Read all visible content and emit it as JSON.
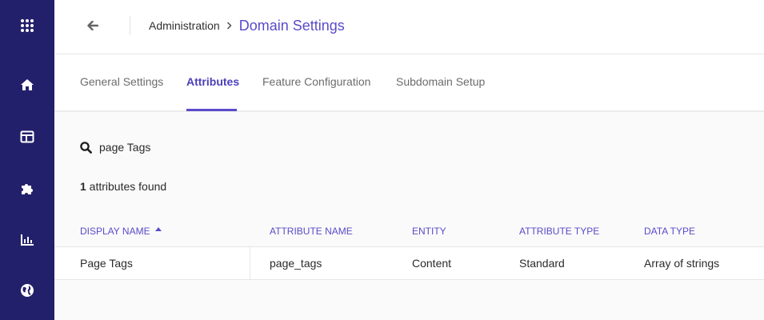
{
  "sidebar": {
    "items": [
      {
        "icon": "apps-grid-icon"
      },
      {
        "icon": "home-icon"
      },
      {
        "icon": "layout-icon"
      },
      {
        "icon": "puzzle-icon"
      },
      {
        "icon": "bar-chart-icon"
      },
      {
        "icon": "globe-icon"
      }
    ]
  },
  "header": {
    "breadcrumb_parent": "Administration",
    "breadcrumb_current": "Domain Settings"
  },
  "tabs": [
    {
      "label": "General Settings",
      "active": false
    },
    {
      "label": "Attributes",
      "active": true
    },
    {
      "label": "Feature Configuration",
      "active": false
    },
    {
      "label": "Subdomain Setup",
      "active": false
    }
  ],
  "search": {
    "value": "page Tags"
  },
  "results": {
    "count": "1",
    "suffix": " attributes found"
  },
  "table": {
    "columns": [
      "Display Name",
      "Attribute Name",
      "Entity",
      "Attribute Type",
      "Data Type"
    ],
    "sorted_column": "Display Name",
    "sort_direction": "ascending",
    "rows": [
      [
        "Page Tags",
        "page_tags",
        "Content",
        "Standard",
        "Array of strings"
      ]
    ]
  },
  "colors": {
    "sidebar_bg": "#23206b",
    "accent": "#5a4bc9",
    "page_bg": "#fafafa"
  }
}
